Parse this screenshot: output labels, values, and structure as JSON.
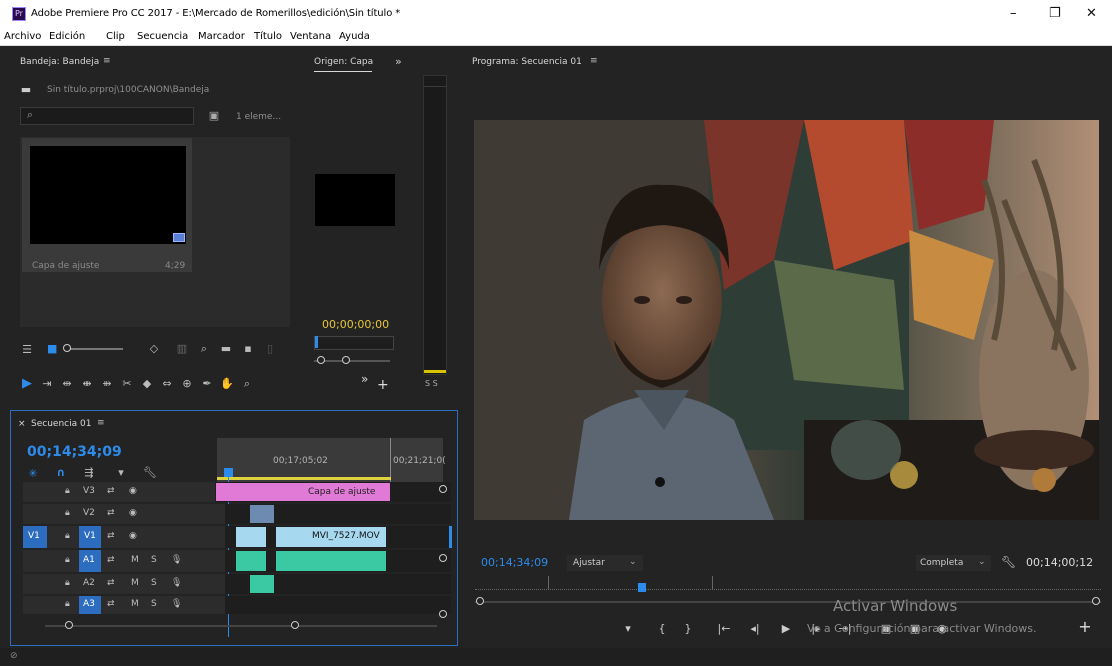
{
  "window": {
    "title": "Adobe Premiere Pro CC 2017 - E:\\Mercado de Romerillos\\edición\\Sin título *",
    "app_icon": "Pr"
  },
  "menu": [
    "Archivo",
    "Edición",
    "Clip",
    "Secuencia",
    "Marcador",
    "Título",
    "Ventana",
    "Ayuda"
  ],
  "project_panel": {
    "tab": "Bandeja: Bandeja",
    "path": "Sin título.prproj\\100CANON\\Bandeja",
    "search_placeholder": "",
    "items_count": "1 eleme...",
    "item": {
      "name": "Capa de ajuste",
      "duration": "4;29"
    }
  },
  "source_panel": {
    "tab": "Origen: Capa",
    "timecode": "00;00;00;00",
    "meter_ss": "S S"
  },
  "program_panel": {
    "tab": "Programa: Secuencia 01",
    "timecode": "00;14;34;09",
    "fit": "Ajustar",
    "quality": "Completa",
    "duration": "00;14;00;12"
  },
  "timeline": {
    "tab": "Secuencia 01",
    "timecode": "00;14;34;09",
    "ruler_labels": [
      "00;17;05;02",
      "00;21;21;0("
    ],
    "tracks": [
      {
        "name": "V3",
        "clip": "Capa de ajuste"
      },
      {
        "name": "V2",
        "clip": ""
      },
      {
        "name": "V1",
        "source": "V1",
        "clip": "MVI_7527.MOV"
      },
      {
        "name": "A1",
        "source": "A1"
      },
      {
        "name": "A2"
      },
      {
        "name": "A3"
      }
    ],
    "audio_buttons": {
      "mute": "M",
      "solo": "S"
    }
  },
  "watermark": {
    "title": "Activar Windows",
    "subtitle": "Ve a Configuración para activar Windows."
  },
  "colors": {
    "accent": "#2d8ceb",
    "timecode_yellow": "#e7c53b",
    "adjustment_clip": "#e07ad6",
    "video_clip": "#a6d8f0",
    "audio_clip": "#3bc9a3",
    "playhead": "#2d8ceb"
  }
}
